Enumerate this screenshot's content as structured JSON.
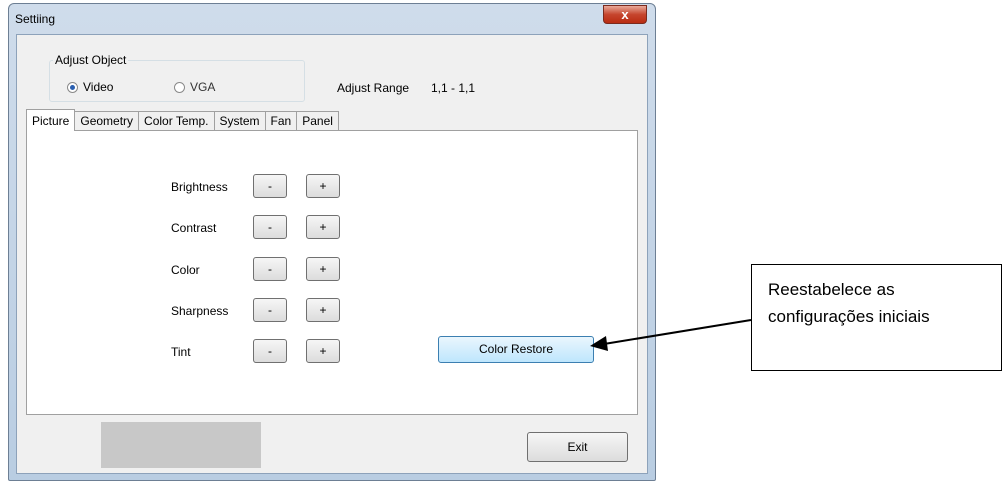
{
  "window": {
    "title": "Settiing",
    "close_glyph": "x"
  },
  "adjust_object": {
    "legend": "Adjust Object",
    "options": [
      {
        "label": "Video",
        "selected": true
      },
      {
        "label": "VGA",
        "selected": false
      }
    ]
  },
  "adjust_range": {
    "label": "Adjust Range",
    "value": "1,1 - 1,1"
  },
  "tabs": [
    {
      "label": "Picture",
      "active": true
    },
    {
      "label": "Geometry",
      "active": false
    },
    {
      "label": "Color Temp.",
      "active": false
    },
    {
      "label": "System",
      "active": false
    },
    {
      "label": "Fan",
      "active": false
    },
    {
      "label": "Panel",
      "active": false
    }
  ],
  "picture": {
    "rows": [
      {
        "label": "Brightness",
        "minus": "-",
        "plus": "+"
      },
      {
        "label": "Contrast",
        "minus": "-",
        "plus": "+"
      },
      {
        "label": "Color",
        "minus": "-",
        "plus": "+"
      },
      {
        "label": "Sharpness",
        "minus": "-",
        "plus": "+"
      },
      {
        "label": "Tint",
        "minus": "-",
        "plus": "+"
      }
    ],
    "restore_label": "Color Restore"
  },
  "footer": {
    "exit_label": "Exit"
  },
  "callout": {
    "line1": "Reestabelece as",
    "line2": "configurações iniciais"
  }
}
